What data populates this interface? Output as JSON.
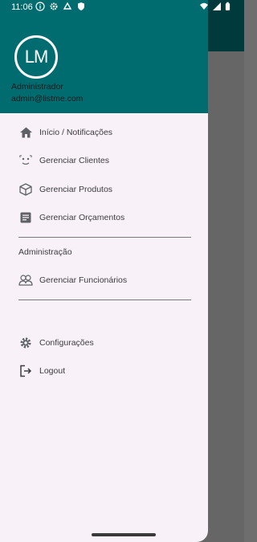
{
  "status_bar": {
    "time": "11:06"
  },
  "user": {
    "logo_text": "LM",
    "name": "Administrador",
    "email": "admin@listme.com"
  },
  "menu": {
    "items": [
      {
        "label": "Início / Notificações",
        "icon": "home-icon"
      },
      {
        "label": "Gerenciar Clientes",
        "icon": "face-icon"
      },
      {
        "label": "Gerenciar Produtos",
        "icon": "box-icon"
      },
      {
        "label": "Gerenciar Orçamentos",
        "icon": "document-icon"
      }
    ],
    "section_title": "Administração",
    "admin_items": [
      {
        "label": "Gerenciar Funcionários",
        "icon": "group-icon"
      }
    ],
    "bottom_items": [
      {
        "label": "Configurações",
        "icon": "gear-icon"
      },
      {
        "label": "Logout",
        "icon": "logout-icon"
      }
    ]
  },
  "colors": {
    "header": "#006c70",
    "drawer_bg": "#f8f1f7",
    "scrim": "#666666"
  }
}
